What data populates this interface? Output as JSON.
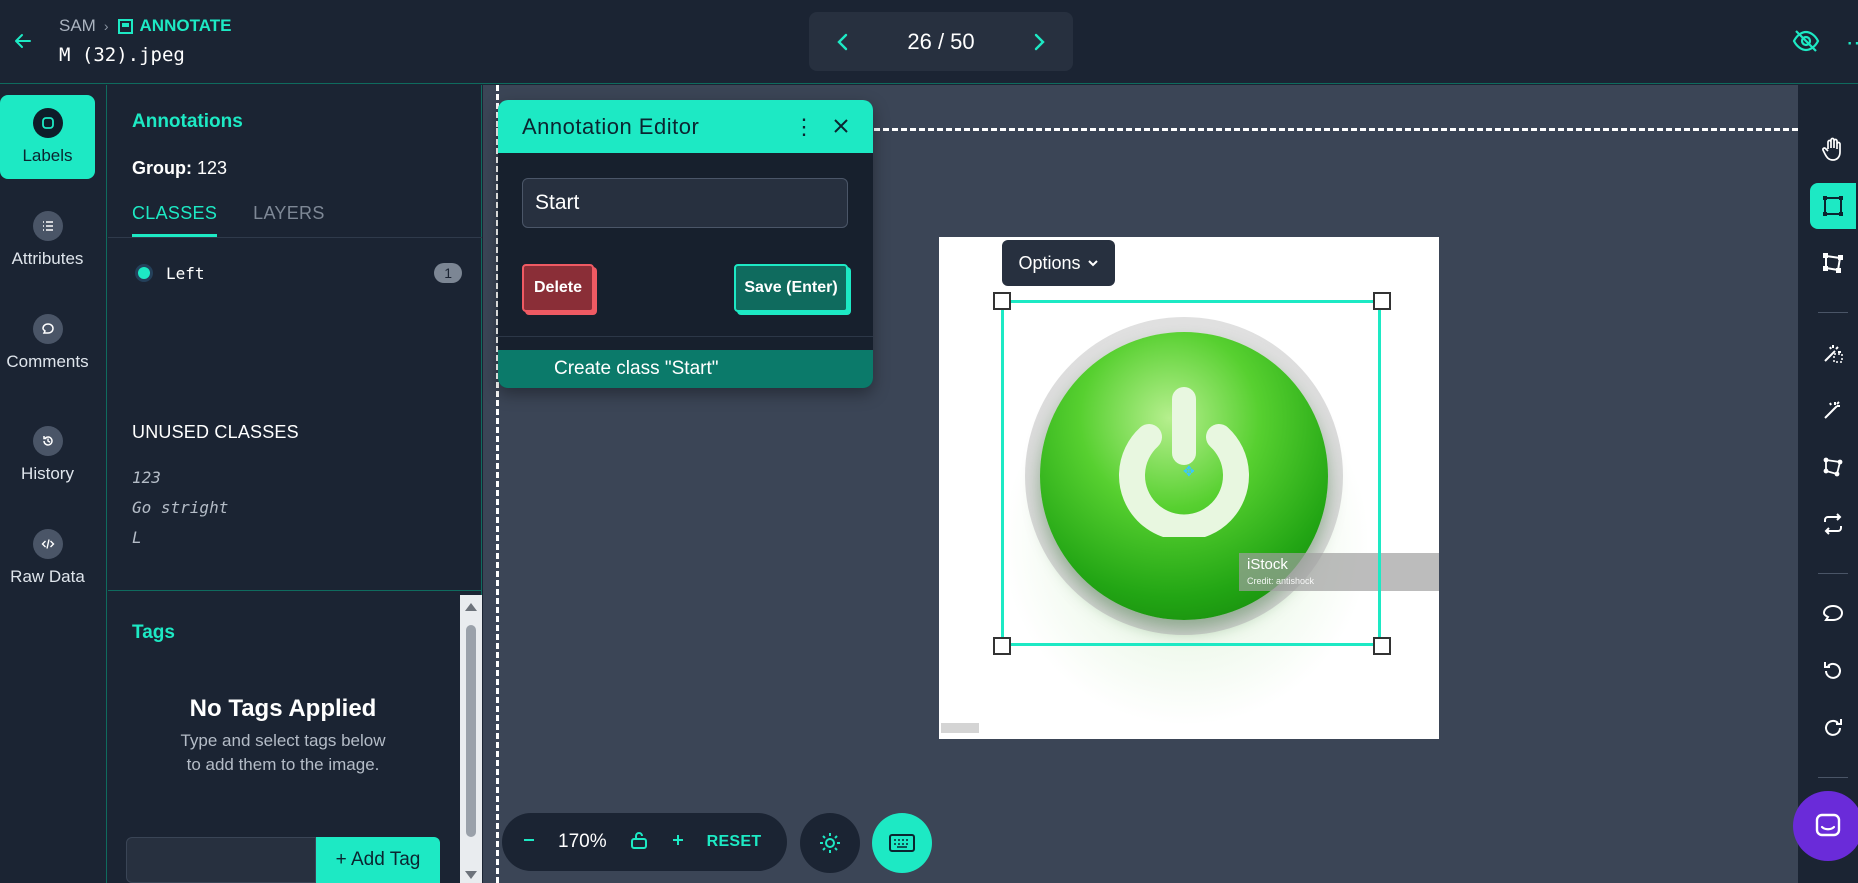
{
  "header": {
    "breadcrumb_root": "SAM",
    "breadcrumb_current": "ANNOTATE",
    "filename": "M (32).jpeg",
    "page_counter": "26 / 50"
  },
  "rail": {
    "items": [
      {
        "label": "Labels",
        "icon": "tag-icon",
        "active": true
      },
      {
        "label": "Attributes",
        "icon": "list-icon"
      },
      {
        "label": "Comments",
        "icon": "comment-icon"
      },
      {
        "label": "History",
        "icon": "history-icon"
      },
      {
        "label": "Raw Data",
        "icon": "code-icon"
      }
    ]
  },
  "panel": {
    "title": "Annotations",
    "group_label": "Group:",
    "group_value": "123",
    "tabs": [
      "CLASSES",
      "LAYERS"
    ],
    "classes": [
      {
        "name": "Left",
        "count": "1"
      }
    ],
    "unused_title": "UNUSED CLASSES",
    "unused_classes": [
      "123",
      "Go stright",
      "L"
    ],
    "tags_title": "Tags",
    "no_tags_title": "No Tags Applied",
    "no_tags_line1": "Type and select tags below",
    "no_tags_line2": "to add them to the image.",
    "add_tag_label": "+ Add Tag"
  },
  "editor": {
    "title": "Annotation Editor",
    "input_value": "Start",
    "delete_label": "Delete",
    "save_label": "Save (Enter)",
    "create_class_label": "Create class \"Start\""
  },
  "canvas": {
    "options_label": "Options",
    "watermark_title": "iStock",
    "watermark_credit": "Credit: antishock"
  },
  "zoom": {
    "value": "170%",
    "reset_label": "RESET"
  },
  "colors": {
    "accent": "#1de9c4",
    "background": "#1b2433",
    "canvas": "#3b4556",
    "danger": "#8a2e37",
    "launcher": "#6a2bd9"
  }
}
